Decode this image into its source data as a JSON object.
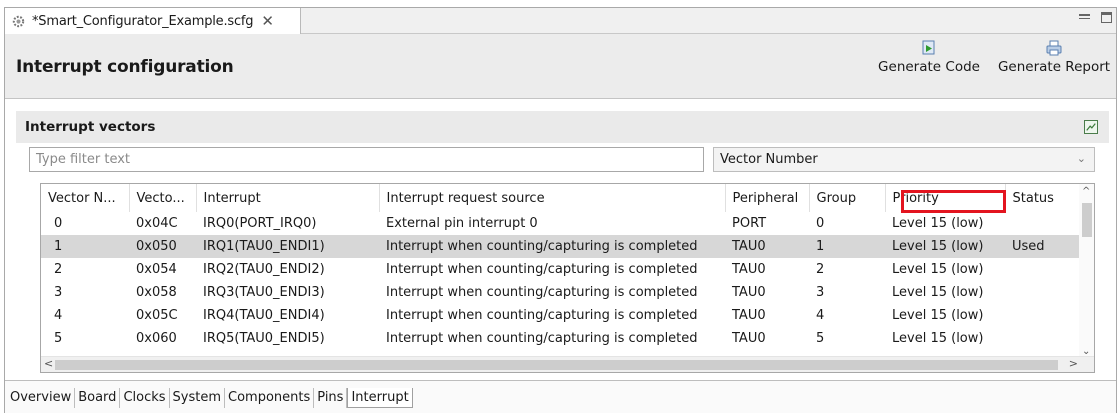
{
  "editor_tab": {
    "title": "*Smart_Configurator_Example.scfg",
    "close": "✕"
  },
  "header": {
    "title": "Interrupt configuration",
    "generate_code": "Generate Code",
    "generate_report": "Generate Report"
  },
  "section": {
    "title": "Interrupt vectors"
  },
  "filter": {
    "placeholder": "Type filter text"
  },
  "sort_select": {
    "value": "Vector Number"
  },
  "table": {
    "columns": [
      "Vector N...",
      "Vecto...",
      "Interrupt",
      "Interrupt request source",
      "Peripheral",
      "Group",
      "Priority",
      "Status"
    ],
    "rows": [
      [
        "0",
        "0x04C",
        "IRQ0(PORT_IRQ0)",
        "External pin interrupt 0",
        "PORT",
        "0",
        "Level 15 (low)",
        ""
      ],
      [
        "1",
        "0x050",
        "IRQ1(TAU0_ENDI1)",
        "Interrupt when counting/capturing is completed",
        "TAU0",
        "1",
        "Level 15 (low)",
        "Used"
      ],
      [
        "2",
        "0x054",
        "IRQ2(TAU0_ENDI2)",
        "Interrupt when counting/capturing is completed",
        "TAU0",
        "2",
        "Level 15 (low)",
        ""
      ],
      [
        "3",
        "0x058",
        "IRQ3(TAU0_ENDI3)",
        "Interrupt when counting/capturing is completed",
        "TAU0",
        "3",
        "Level 15 (low)",
        ""
      ],
      [
        "4",
        "0x05C",
        "IRQ4(TAU0_ENDI4)",
        "Interrupt when counting/capturing is completed",
        "TAU0",
        "4",
        "Level 15 (low)",
        ""
      ],
      [
        "5",
        "0x060",
        "IRQ5(TAU0_ENDI5)",
        "Interrupt when counting/capturing is completed",
        "TAU0",
        "5",
        "Level 15 (low)",
        ""
      ]
    ],
    "selected_row": 1,
    "highlighted_column": "Priority",
    "highlight_color": "#e3141f"
  },
  "bottom_tabs": [
    "Overview",
    "Board",
    "Clocks",
    "System",
    "Components",
    "Pins",
    "Interrupt"
  ],
  "active_bottom_tab": "Interrupt",
  "icons": {
    "editor_tab": "gear-icon",
    "generate_code": "generate-code-icon",
    "generate_report": "print-icon",
    "section": "collapse-icon"
  },
  "colors": {
    "header_bg": "#ececec",
    "section_bg": "#eaeaea",
    "selected_row": "#d7d7d7"
  }
}
